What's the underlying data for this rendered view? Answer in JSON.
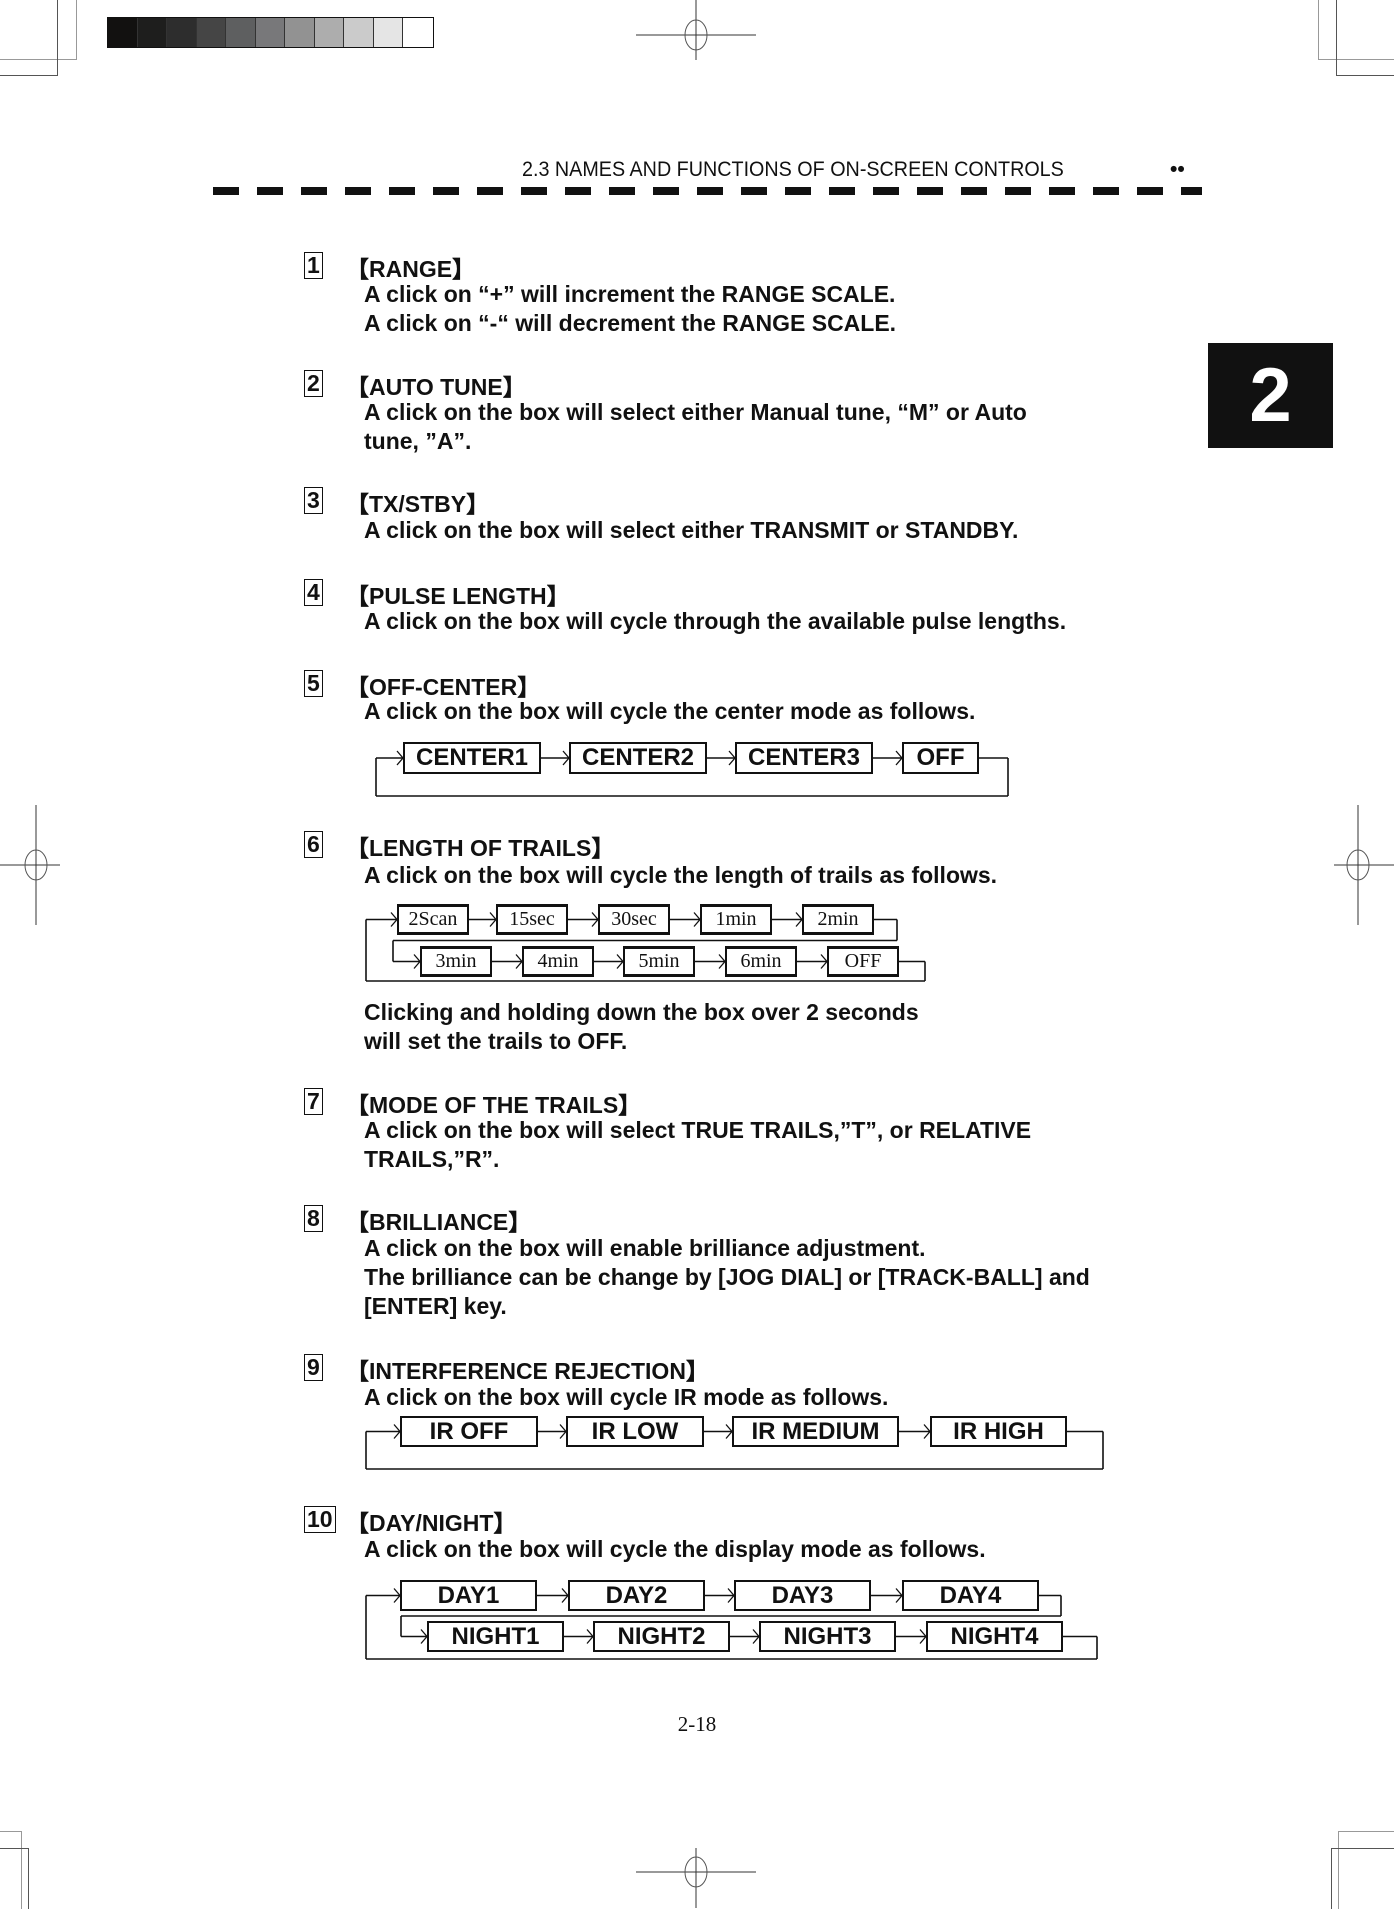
{
  "header": {
    "section_title": "2.3 NAMES AND FUNCTIONS OF ON-SCREEN CONTROLS",
    "dots": "••"
  },
  "chapter_tab": {
    "label": "2"
  },
  "gray_scale": [
    "#121110",
    "#1e1e1d",
    "#2d2d2d",
    "#454545",
    "#5e5f60",
    "#78787a",
    "#929292",
    "#adadad",
    "#cbcbcb",
    "#e5e5e5",
    "#ffffff"
  ],
  "items": [
    {
      "num": "1",
      "title": "【RANGE】",
      "body": "A click on “+” will increment the RANGE SCALE.\nA click on “-“ will decrement the RANGE SCALE."
    },
    {
      "num": "2",
      "title": "【AUTO TUNE】",
      "body": "A click on the box will select either Manual tune, “M” or Auto\ntune, ”A”."
    },
    {
      "num": "3",
      "title": "【TX/STBY】",
      "body": "A click on the box will select either TRANSMIT or STANDBY."
    },
    {
      "num": "4",
      "title": "【PULSE LENGTH】",
      "body": "A click on the box will cycle through the available pulse lengths."
    },
    {
      "num": "5",
      "title": "【OFF-CENTER】",
      "body": "A click on the box will cycle the center mode as follows."
    },
    {
      "num": "6",
      "title": "【LENGTH OF TRAILS】",
      "body": "A click on the box will cycle the length of trails as follows.",
      "note": "Clicking and holding down the box over 2 seconds\nwill set the trails to OFF."
    },
    {
      "num": "7",
      "title": "【MODE OF THE TRAILS】",
      "body": "A click on the box will select TRUE TRAILS,”T”, or RELATIVE\nTRAILS,”R”."
    },
    {
      "num": "8",
      "title": "【BRILLIANCE】",
      "body": "A click on the box will enable brilliance adjustment.\nThe brilliance can be change by [JOG DIAL] or [TRACK-BALL] and\n[ENTER] key."
    },
    {
      "num": "9",
      "title": "【INTERFERENCE REJECTION】",
      "body": "A click on the box will cycle IR mode as follows."
    },
    {
      "num": "10",
      "title": "【DAY/NIGHT】",
      "body": "A click on the box will cycle the display mode as follows."
    }
  ],
  "flows": {
    "off_center": [
      "CENTER1",
      "CENTER2",
      "CENTER3",
      "OFF"
    ],
    "trails_row1": [
      "2Scan",
      "15sec",
      "30sec",
      "1min",
      "2min"
    ],
    "trails_row2": [
      "3min",
      "4min",
      "5min",
      "6min",
      "OFF"
    ],
    "ir": [
      "IR OFF",
      "IR LOW",
      "IR MEDIUM",
      "IR HIGH"
    ],
    "day": [
      "DAY1",
      "DAY2",
      "DAY3",
      "DAY4"
    ],
    "night": [
      "NIGHT1",
      "NIGHT2",
      "NIGHT3",
      "NIGHT4"
    ]
  },
  "footer": {
    "page_number": "2-18"
  }
}
